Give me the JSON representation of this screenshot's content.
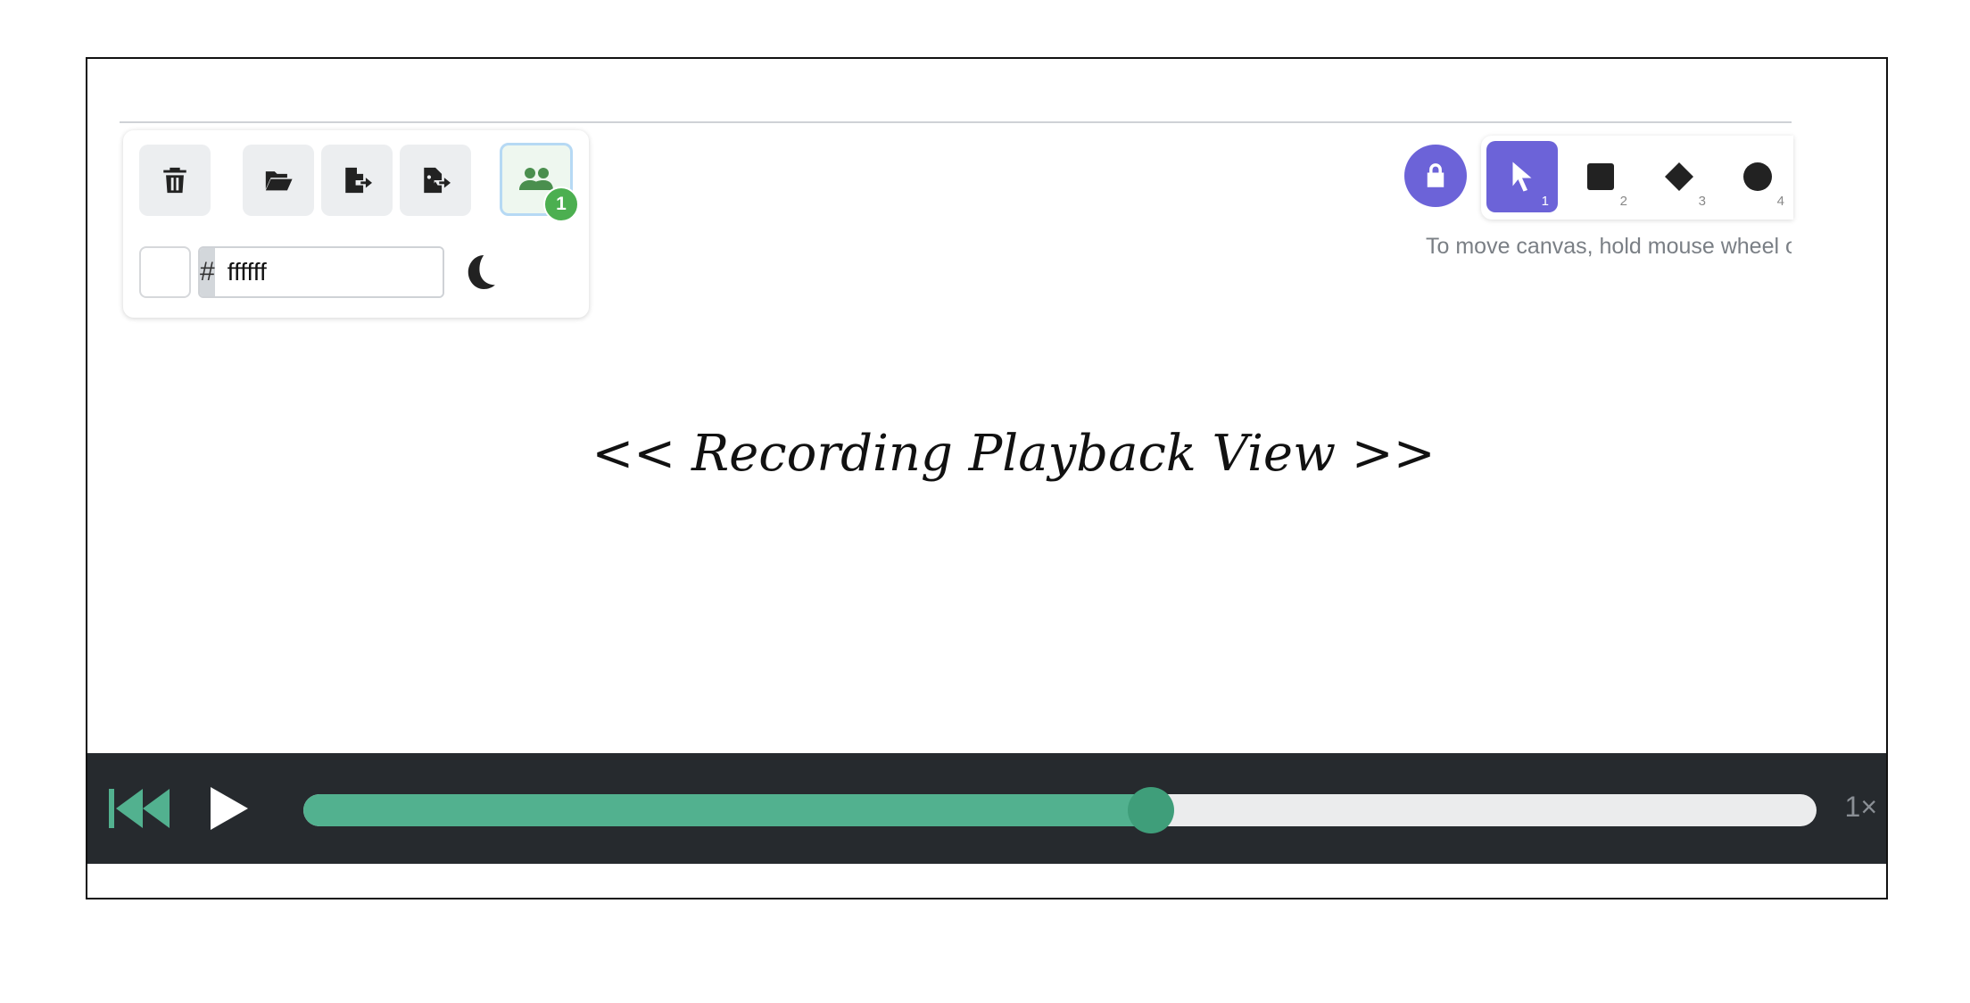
{
  "toolbar": {
    "delete_icon": "trash-icon",
    "open_icon": "folder-open-icon",
    "export_file_icon": "file-export-icon",
    "export_image_icon": "file-image-export-icon",
    "collaborators_icon": "users-icon",
    "collaborators_count": "1",
    "color_prefix": "#",
    "color_value": "ffffff",
    "theme_icon": "moon-icon"
  },
  "tools": {
    "lock_icon": "lock-icon",
    "items": [
      {
        "name": "selection",
        "icon": "pointer-icon",
        "shortcut": "1",
        "active": true
      },
      {
        "name": "rectangle",
        "icon": "square-icon",
        "shortcut": "2",
        "active": false
      },
      {
        "name": "diamond",
        "icon": "diamond-icon",
        "shortcut": "3",
        "active": false
      },
      {
        "name": "ellipse",
        "icon": "circle-icon",
        "shortcut": "4",
        "active": false
      }
    ],
    "hint": "To move canvas, hold mouse wheel or spacebar while dragging"
  },
  "canvas": {
    "label": "<< Recording Playback View >>"
  },
  "player": {
    "rewind_icon": "rewind-to-start-icon",
    "play_icon": "play-icon",
    "progress": 0.56,
    "speed": "1×"
  },
  "colors": {
    "accent": "#6c63d8",
    "progress": "#52b18f",
    "player_bg": "#262a2e",
    "badge": "#4caf50"
  }
}
